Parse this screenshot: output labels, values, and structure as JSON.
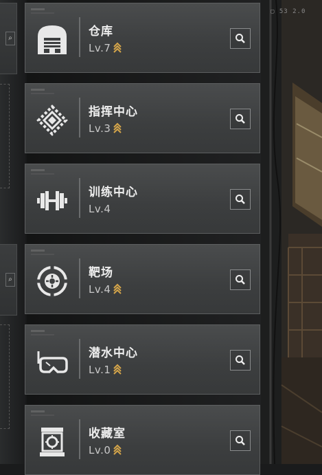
{
  "hud": {
    "value_a": "53",
    "value_b": "2.0"
  },
  "facilities": [
    {
      "name": "仓库",
      "level": "Lv.7",
      "upgradable": true,
      "icon": "warehouse-icon"
    },
    {
      "name": "指挥中心",
      "level": "Lv.3",
      "upgradable": true,
      "icon": "command-chip-icon"
    },
    {
      "name": "训练中心",
      "level": "Lv.4",
      "upgradable": false,
      "icon": "dumbbell-icon"
    },
    {
      "name": "靶场",
      "level": "Lv.4",
      "upgradable": true,
      "icon": "target-icon"
    },
    {
      "name": "潜水中心",
      "level": "Lv.1",
      "upgradable": true,
      "icon": "diving-mask-icon"
    },
    {
      "name": "收藏室",
      "level": "Lv.0",
      "upgradable": true,
      "icon": "display-case-icon"
    }
  ],
  "colors": {
    "upgrade_chevron": "#d6a64a",
    "card_bg": "#434546",
    "text": "#eeeeee"
  }
}
